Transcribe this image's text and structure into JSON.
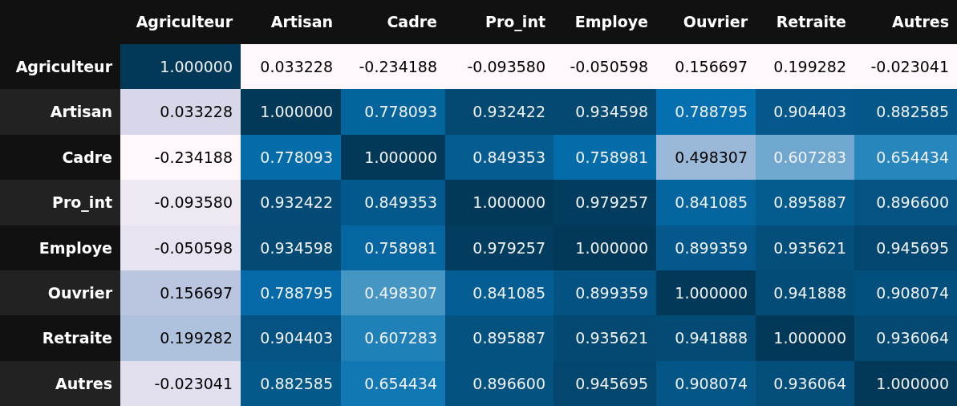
{
  "table": {
    "columns": [
      "Agriculteur",
      "Artisan",
      "Cadre",
      "Pro_int",
      "Employe",
      "Ouvrier",
      "Retraite",
      "Autres"
    ],
    "rows": [
      {
        "label": "Agriculteur",
        "cells": [
          "1.000000",
          "0.033228",
          "-0.234188",
          "-0.093580",
          "-0.050598",
          "0.156697",
          "0.199282",
          "-0.023041"
        ]
      },
      {
        "label": "Artisan",
        "cells": [
          "0.033228",
          "1.000000",
          "0.778093",
          "0.932422",
          "0.934598",
          "0.788795",
          "0.904403",
          "0.882585"
        ]
      },
      {
        "label": "Cadre",
        "cells": [
          "-0.234188",
          "0.778093",
          "1.000000",
          "0.849353",
          "0.758981",
          "0.498307",
          "0.607283",
          "0.654434"
        ]
      },
      {
        "label": "Pro_int",
        "cells": [
          "-0.093580",
          "0.932422",
          "0.849353",
          "1.000000",
          "0.979257",
          "0.841085",
          "0.895887",
          "0.896600"
        ]
      },
      {
        "label": "Employe",
        "cells": [
          "-0.050598",
          "0.934598",
          "0.758981",
          "0.979257",
          "1.000000",
          "0.899359",
          "0.935621",
          "0.945695"
        ]
      },
      {
        "label": "Ouvrier",
        "cells": [
          "0.156697",
          "0.788795",
          "0.498307",
          "0.841085",
          "0.899359",
          "1.000000",
          "0.941888",
          "0.908074"
        ]
      },
      {
        "label": "Retraite",
        "cells": [
          "0.199282",
          "0.904403",
          "0.607283",
          "0.895887",
          "0.935621",
          "0.941888",
          "1.000000",
          "0.936064"
        ]
      },
      {
        "label": "Autres",
        "cells": [
          "-0.023041",
          "0.882585",
          "0.654434",
          "0.896600",
          "0.945695",
          "0.908074",
          "0.936064",
          "1.000000"
        ]
      }
    ]
  }
}
